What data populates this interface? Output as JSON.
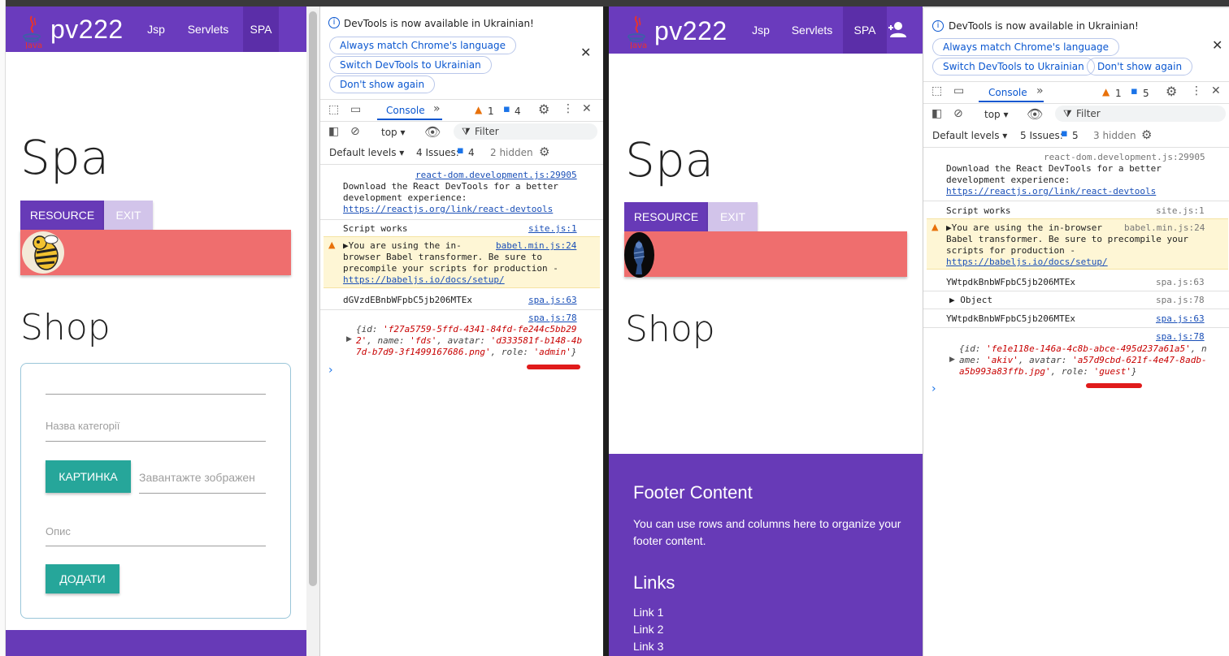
{
  "left_window": {
    "nav": {
      "brand": "pv222",
      "logo_text": "Java",
      "items": [
        "Jsp",
        "Servlets",
        "SPA"
      ]
    },
    "heading": "Spa",
    "resource_button": "RESOURCE",
    "exit_button": "EXIT",
    "shop_heading": "Shop",
    "form": {
      "category_placeholder": "Назва категорії",
      "image_button": "КАРТИНКА",
      "image_placeholder": "Завантажте зображен",
      "description_placeholder": "Опис",
      "add_button": "ДОДАТИ"
    }
  },
  "left_devtools": {
    "banner": "DevTools is now available in Ukrainian!",
    "chips": [
      "Always match Chrome's language",
      "Switch DevTools to Ukrainian",
      "Don't show again"
    ],
    "tab": "Console",
    "warn_count": "1",
    "msg_count": "4",
    "context": "top",
    "filter": "Filter",
    "levels": "Default levels",
    "issues_label": "4 Issues:",
    "issues_count": "4",
    "hidden": "2 hidden",
    "logs": {
      "react_src": "react-dom.development.js:29905",
      "react_msg1": "Download the React DevTools for a better",
      "react_msg2": "development experience:",
      "react_link": "https://reactjs.org/link/react-devtools",
      "script_msg": "Script works",
      "script_src": "site.js:1",
      "babel_msg1": "You are using the in-",
      "babel_msg2": "browser Babel transformer. Be sure to",
      "babel_msg3": "precompile your scripts for production -",
      "babel_link": "https://babeljs.io/docs/setup/",
      "babel_src": "babel.min.js:24",
      "token_msg": "dGVzdEBnbWFpbC5jb206MTEx",
      "token_src": "spa.js:63",
      "obj_src": "spa.js:78",
      "obj_line1_a": "{id: ",
      "obj_line1_b": "'f27a5759-5ffd-4341-84fd-fe244c5bb29",
      "obj_line2_a": "2'",
      "obj_line2_b": ", name: ",
      "obj_line2_c": "'fds'",
      "obj_line2_d": ", avatar: ",
      "obj_line2_e": "'d333581f-b148-4b",
      "obj_line3_a": "7d-b7d9-3f1499167686.png'",
      "obj_line3_b": ", role: ",
      "obj_line3_c": "'admin'",
      "obj_line3_d": "}"
    }
  },
  "right_window": {
    "nav": {
      "brand": "pv222",
      "logo_text": "Java",
      "items": [
        "Jsp",
        "Servlets",
        "SPA"
      ]
    },
    "heading": "Spa",
    "resource_button": "RESOURCE",
    "exit_button": "EXIT",
    "shop_heading": "Shop",
    "footer": {
      "title": "Footer Content",
      "text1": "You can use rows and columns here to organize your",
      "text2": "footer content.",
      "links_title": "Links",
      "links": [
        "Link 1",
        "Link 2",
        "Link 3"
      ]
    }
  },
  "right_devtools": {
    "banner": "DevTools is now available in Ukrainian!",
    "chips": [
      "Always match Chrome's language",
      "Switch DevTools to Ukrainian",
      "Don't show again"
    ],
    "tab": "Console",
    "warn_count": "1",
    "msg_count": "5",
    "context": "top",
    "filter": "Filter",
    "levels": "Default levels",
    "issues_label": "5 Issues:",
    "issues_count": "5",
    "hidden": "3 hidden",
    "logs": {
      "react_src": "react-dom.development.js:29905",
      "react_msg1": "Download the React DevTools for a better",
      "react_msg2": "development experience:",
      "react_link": "https://reactjs.org/link/react-devtools",
      "script_msg": "Script works",
      "script_src": "site.js:1",
      "babel_msg1": "You are using the in-browser",
      "babel_msg2": "Babel transformer. Be sure to precompile your",
      "babel_msg3": "scripts for production -",
      "babel_link": "https://babeljs.io/docs/setup/",
      "babel_src": "babel.min.js:24",
      "token_msg": "YWtpdkBnbWFpbC5jb206MTEx",
      "token_src": "spa.js:63",
      "object_msg": "Object",
      "object_src": "spa.js:78",
      "token2_msg": "YWtpdkBnbWFpbC5jb206MTEx",
      "token2_src": "spa.js:63",
      "obj_src": "spa.js:78",
      "obj_line1_a": "{id: ",
      "obj_line1_b": "'fe1e118e-146a-4c8b-abce-495d237a61a5'",
      "obj_line1_c": ", n",
      "obj_line2_a": "ame: ",
      "obj_line2_b": "'akiv'",
      "obj_line2_c": ", avatar: ",
      "obj_line2_d": "'a57d9cbd-621f-4e47-8adb-",
      "obj_line3_a": "a5b993a83ffb.jpg'",
      "obj_line3_b": ", role: ",
      "obj_line3_c": "'guest'",
      "obj_line3_d": "}"
    }
  },
  "colors": {
    "nav": "#6a3bbd",
    "nav_active": "#5b2ea8",
    "resource": "#673ab7",
    "exit": "#d2c4ea",
    "red_bar": "#ef6e6e",
    "teal": "#26a69a",
    "footer": "#673ab7",
    "red_underline": "#e01b1b"
  }
}
